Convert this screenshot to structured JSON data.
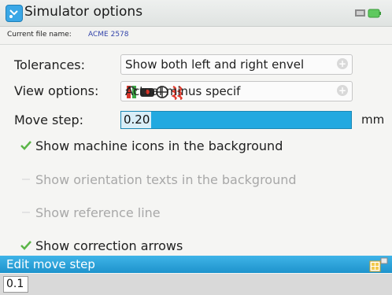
{
  "header": {
    "title": "Simulator options",
    "file_label": "Current file name:",
    "file_name": "ACME 2578"
  },
  "tolerances": {
    "label": "Tolerances:",
    "value": "Show both left and right envel"
  },
  "view_options": {
    "label": "View options:",
    "value": "Actual minus specif",
    "icons": [
      "alignment-icon",
      "coupling-icon",
      "target-icon",
      "spring-icon"
    ]
  },
  "move_step": {
    "label": "Move step:",
    "value": "0.20",
    "unit": "mm"
  },
  "checkboxes": [
    {
      "label": "Show machine icons in the background",
      "checked": true,
      "enabled": true
    },
    {
      "label": "Show orientation texts in the background",
      "checked": false,
      "enabled": false
    },
    {
      "label": "Show reference line",
      "checked": false,
      "enabled": false
    },
    {
      "label": "Show correction arrows",
      "checked": true,
      "enabled": true
    }
  ],
  "edit_bar": {
    "title": "Edit move step"
  },
  "input": {
    "value": "0.1"
  },
  "colors": {
    "accent": "#22a9e0",
    "check": "#5bb548",
    "disabled_text": "#a8a8a8"
  }
}
